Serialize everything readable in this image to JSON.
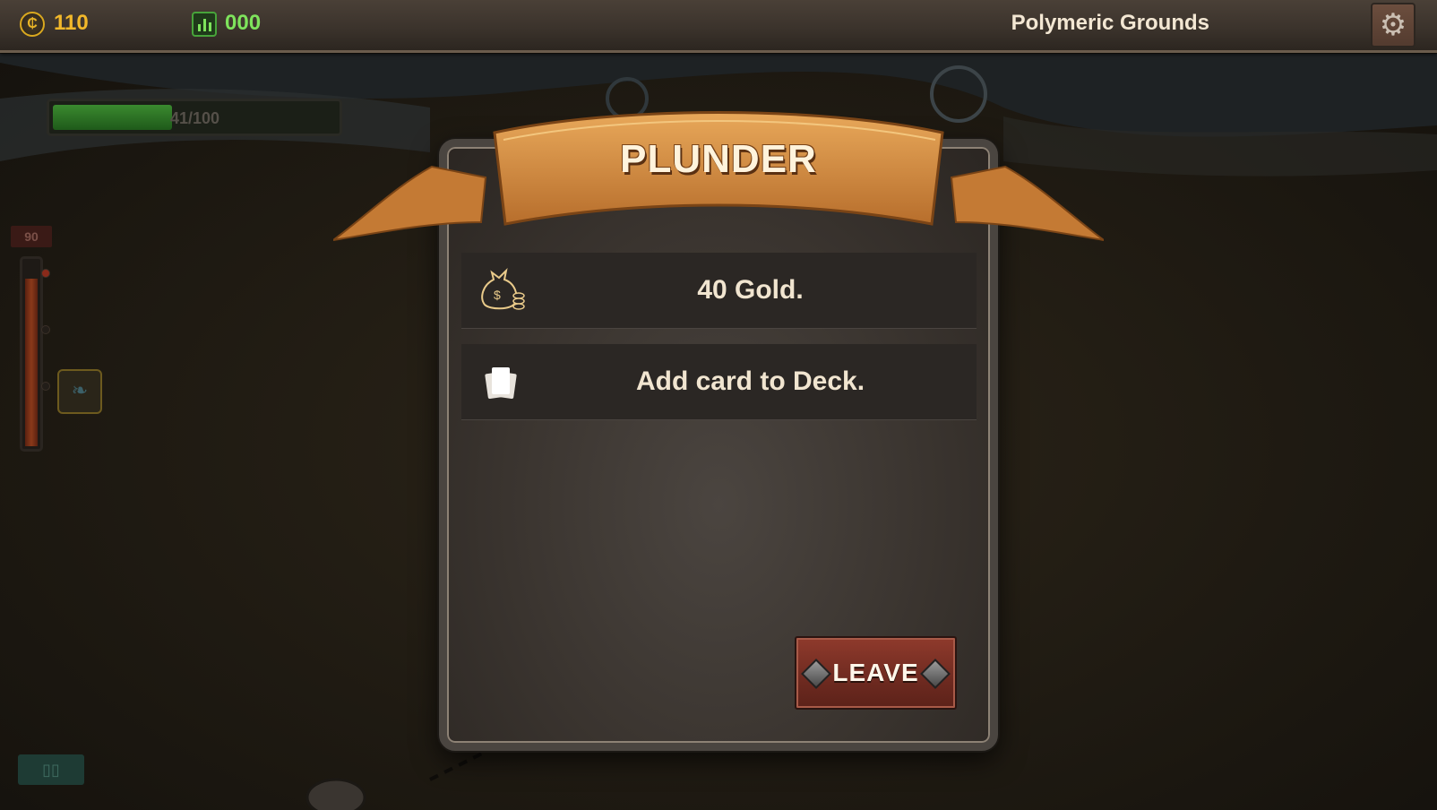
{
  "topbar": {
    "gold_icon": "gold-coin-icon",
    "gold": "110",
    "score_icon": "bar-chart-icon",
    "score": "000",
    "location": "Polymeric Grounds",
    "settings_icon": "gear-icon"
  },
  "hud": {
    "hp_text": "41/100",
    "hp_fraction": 0.41,
    "level": "90",
    "meter_fraction": 0.88
  },
  "dialog": {
    "title": "PLUNDER",
    "rewards": [
      {
        "icon": "money-bag-icon",
        "label": "40 Gold."
      },
      {
        "icon": "cards-icon",
        "label": "Add card to Deck."
      }
    ],
    "leave_label": "LEAVE"
  },
  "colors": {
    "gold": "#f2b82a",
    "score": "#7ee35c",
    "banner": "#d48a3a",
    "leave": "#7e3226"
  }
}
